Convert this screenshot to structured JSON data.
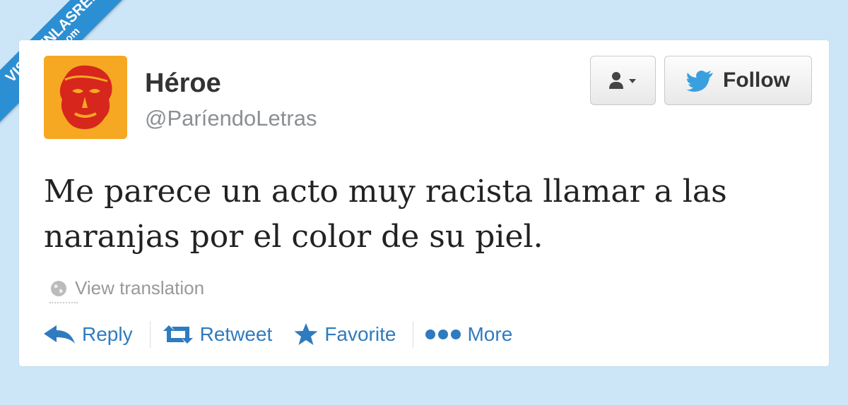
{
  "watermark": {
    "line1": "VISTOENLASREDES",
    "line2": ".com"
  },
  "profile": {
    "name": "Héroe",
    "handle": "@ParíendoLetras"
  },
  "header": {
    "follow_label": "Follow"
  },
  "tweet": {
    "text": "Me parece un acto muy racista llamar a las naranjas por el color de su piel."
  },
  "translation": {
    "label": "View translation"
  },
  "actions": {
    "reply": "Reply",
    "retweet": "Retweet",
    "favorite": "Favorite",
    "more": "More"
  },
  "colors": {
    "background": "#cde6f7",
    "accent": "#2f7bbf",
    "avatar_bg": "#f6a823",
    "avatar_face": "#d7261c",
    "banner": "#2d8fd3"
  },
  "icons": [
    "globe-icon",
    "reply-icon",
    "retweet-icon",
    "star-icon",
    "more-dots-icon",
    "user-icon",
    "twitter-bird-icon"
  ]
}
